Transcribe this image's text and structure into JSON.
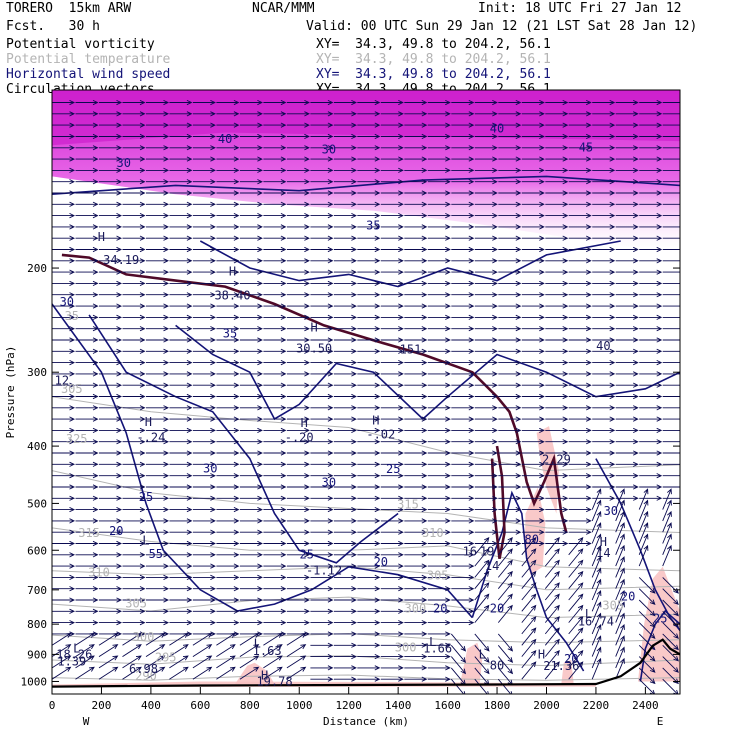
{
  "header": {
    "model": "TORERO  15km ARW",
    "center": "NCAR/MMM",
    "init": "Init: 18 UTC Fri 27 Jan 12",
    "fcst": "Fcst.   30 h",
    "valid": "Valid: 00 UTC Sun 29 Jan 12 (21 LST Sat 28 Jan 12)"
  },
  "fields": [
    {
      "name": "Potential vorticity",
      "xy": "XY=  34.3, 49.8 to 204.2, 56.1",
      "color": "#000000"
    },
    {
      "name": "Potential temperature",
      "xy": "XY=  34.3, 49.8 to 204.2, 56.1",
      "color": "#b4b4b4"
    },
    {
      "name": "Horizontal wind speed",
      "xy": "XY=  34.3, 49.8 to 204.2, 56.1",
      "color": "#141478"
    },
    {
      "name": "Circulation vectors",
      "xy": "XY=  34.3, 49.8 to 204.2, 56.1",
      "color": "#000000"
    }
  ],
  "colors": {
    "wind_contour": "#141478",
    "theta_contour": "#b4b4b4",
    "pv_fill": "#e040e0",
    "pv_light": "#f0a0f0",
    "pv_low": "#f8c0c0",
    "tropopause": "#500a28",
    "arrow": "#0a0a50",
    "terrain": "#000000"
  },
  "chart_data": {
    "type": "cross-section",
    "xlabel": "Distance (km)",
    "ylabel": "Pressure (hPa)",
    "xlim": [
      0,
      2540
    ],
    "ylim": [
      1050,
      100
    ],
    "xticks": [
      0,
      200,
      400,
      600,
      800,
      1000,
      1200,
      1400,
      1600,
      1800,
      2000,
      2200,
      2400
    ],
    "yticks": [
      200,
      300,
      400,
      500,
      600,
      700,
      800,
      900,
      1000
    ],
    "y_scale": "log",
    "x_end_labels": {
      "left": "W",
      "right": "E"
    },
    "wind_speed_labels": [
      {
        "x": 290,
        "p": 135,
        "text": "30"
      },
      {
        "x": 700,
        "p": 123,
        "text": "40"
      },
      {
        "x": 1120,
        "p": 128,
        "text": "30"
      },
      {
        "x": 1800,
        "p": 118,
        "text": "40"
      },
      {
        "x": 2160,
        "p": 127,
        "text": "45"
      },
      {
        "x": 60,
        "p": 232,
        "text": "30"
      },
      {
        "x": 1300,
        "p": 172,
        "text": "35"
      },
      {
        "x": 720,
        "p": 262,
        "text": "35"
      },
      {
        "x": 640,
        "p": 443,
        "text": "30"
      },
      {
        "x": 1120,
        "p": 468,
        "text": "30"
      },
      {
        "x": 1380,
        "p": 444,
        "text": "25"
      },
      {
        "x": 380,
        "p": 495,
        "text": "25"
      },
      {
        "x": 260,
        "p": 565,
        "text": "20"
      },
      {
        "x": 420,
        "p": 618,
        "text": "55"
      },
      {
        "x": 1030,
        "p": 620,
        "text": "25"
      },
      {
        "x": 1330,
        "p": 638,
        "text": "20"
      },
      {
        "x": 1570,
        "p": 765,
        "text": "20"
      },
      {
        "x": 1800,
        "p": 765,
        "text": "20"
      },
      {
        "x": 1940,
        "p": 585,
        "text": "80"
      },
      {
        "x": 2260,
        "p": 523,
        "text": "30"
      },
      {
        "x": 2330,
        "p": 730,
        "text": "20"
      },
      {
        "x": 2460,
        "p": 795,
        "text": "25"
      },
      {
        "x": 2100,
        "p": 930,
        "text": "20"
      }
    ],
    "theta_labels": [
      {
        "x": 80,
        "p": 245,
        "text": "35"
      },
      {
        "x": 80,
        "p": 325,
        "text": "305"
      },
      {
        "x": 100,
        "p": 395,
        "text": "325"
      },
      {
        "x": 150,
        "p": 570,
        "text": "315"
      },
      {
        "x": 190,
        "p": 665,
        "text": "310"
      },
      {
        "x": 340,
        "p": 750,
        "text": "305"
      },
      {
        "x": 370,
        "p": 855,
        "text": "300"
      },
      {
        "x": 460,
        "p": 925,
        "text": "295"
      },
      {
        "x": 380,
        "p": 995,
        "text": "290"
      },
      {
        "x": 1440,
        "p": 510,
        "text": "315"
      },
      {
        "x": 1540,
        "p": 570,
        "text": "310"
      },
      {
        "x": 1560,
        "p": 672,
        "text": "305"
      },
      {
        "x": 1470,
        "p": 765,
        "text": "300"
      },
      {
        "x": 1430,
        "p": 890,
        "text": "300"
      },
      {
        "x": 2270,
        "p": 755,
        "text": "305"
      }
    ],
    "pv_labels": [
      {
        "x": 200,
        "p": 180,
        "text": "H"
      },
      {
        "x": 280,
        "p": 197,
        "text": "34.19"
      },
      {
        "x": 730,
        "p": 206,
        "text": "H"
      },
      {
        "x": 730,
        "p": 226,
        "text": "38.40"
      },
      {
        "x": 1060,
        "p": 256,
        "text": "H"
      },
      {
        "x": 1060,
        "p": 278,
        "text": "30.50"
      },
      {
        "x": 1450,
        "p": 279,
        "text": "151"
      },
      {
        "x": 2230,
        "p": 275,
        "text": "40"
      },
      {
        "x": 40,
        "p": 315,
        "text": "12"
      },
      {
        "x": 390,
        "p": 370,
        "text": "H"
      },
      {
        "x": 400,
        "p": 393,
        "text": "-.24"
      },
      {
        "x": 1020,
        "p": 371,
        "text": "H"
      },
      {
        "x": 1000,
        "p": 393,
        "text": "-.20"
      },
      {
        "x": 1310,
        "p": 368,
        "text": "H"
      },
      {
        "x": 1330,
        "p": 388,
        "text": "-.02"
      },
      {
        "x": 2040,
        "p": 428,
        "text": "2.29"
      },
      {
        "x": 380,
        "p": 587,
        "text": "L"
      },
      {
        "x": 1100,
        "p": 660,
        "text": "-1.12"
      },
      {
        "x": 1690,
        "p": 612,
        "text": "16"
      },
      {
        "x": 1760,
        "p": 612,
        "text": "19"
      },
      {
        "x": 1780,
        "p": 648,
        "text": "14"
      },
      {
        "x": 2230,
        "p": 590,
        "text": "H"
      },
      {
        "x": 2230,
        "p": 616,
        "text": "14"
      },
      {
        "x": 2170,
        "p": 781,
        "text": "L"
      },
      {
        "x": 2200,
        "p": 805,
        "text": "16.74"
      },
      {
        "x": 100,
        "p": 893,
        "text": "L"
      },
      {
        "x": 90,
        "p": 914,
        "text": "18.26"
      },
      {
        "x": 80,
        "p": 940,
        "text": "1.39"
      },
      {
        "x": 370,
        "p": 968,
        "text": "6.98"
      },
      {
        "x": 830,
        "p": 876,
        "text": "L"
      },
      {
        "x": 870,
        "p": 902,
        "text": "1.63"
      },
      {
        "x": 1540,
        "p": 871,
        "text": "L"
      },
      {
        "x": 1560,
        "p": 893,
        "text": "1.66"
      },
      {
        "x": 1740,
        "p": 915,
        "text": "L"
      },
      {
        "x": 1980,
        "p": 915,
        "text": "H"
      },
      {
        "x": 1800,
        "p": 955,
        "text": "80"
      },
      {
        "x": 2060,
        "p": 956,
        "text": "21.36"
      },
      {
        "x": 860,
        "p": 993,
        "text": "H"
      },
      {
        "x": 900,
        "p": 1016,
        "text": "19.78"
      }
    ]
  }
}
